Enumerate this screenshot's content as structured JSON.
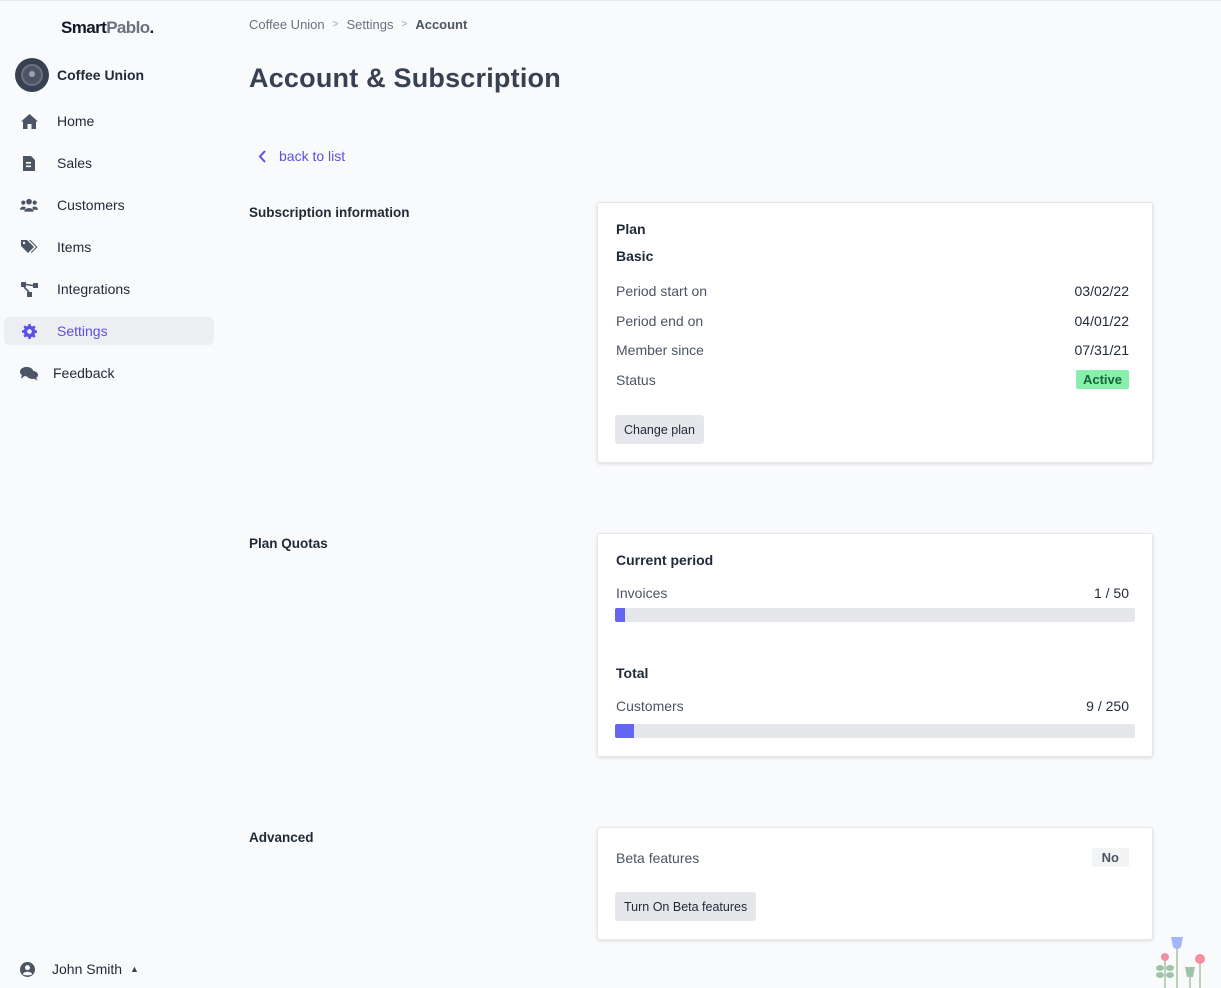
{
  "brand": {
    "smart": "Smart",
    "pablo": "Pablo",
    "dot": "."
  },
  "org": {
    "name": "Coffee Union"
  },
  "sidebar": {
    "items": [
      {
        "label": "Home",
        "icon": "home-icon"
      },
      {
        "label": "Sales",
        "icon": "invoice-icon"
      },
      {
        "label": "Customers",
        "icon": "users-icon"
      },
      {
        "label": "Items",
        "icon": "tags-icon"
      },
      {
        "label": "Integrations",
        "icon": "integrations-icon"
      },
      {
        "label": "Settings",
        "icon": "gear-icon",
        "active": true
      },
      {
        "label": "Feedback",
        "icon": "comments-icon"
      }
    ],
    "user": "John Smith"
  },
  "breadcrumb": [
    "Coffee Union",
    "Settings",
    "Account"
  ],
  "page": {
    "title": "Account & Subscription",
    "back_label": "back to list"
  },
  "subscription": {
    "section_label": "Subscription information",
    "plan_heading": "Plan",
    "plan_name": "Basic",
    "rows": [
      {
        "label": "Period start on",
        "value": "03/02/22"
      },
      {
        "label": "Period end on",
        "value": "04/01/22"
      },
      {
        "label": "Member since",
        "value": "07/31/21"
      }
    ],
    "status_label": "Status",
    "status_value": "Active",
    "change_plan_label": "Change plan"
  },
  "quotas": {
    "section_label": "Plan Quotas",
    "current_heading": "Current period",
    "invoices_label": "Invoices",
    "invoices_value": "1 / 50",
    "invoices_fraction": 0.02,
    "total_heading": "Total",
    "customers_label": "Customers",
    "customers_value": "9 / 250",
    "customers_fraction": 0.036
  },
  "advanced": {
    "section_label": "Advanced",
    "beta_label": "Beta features",
    "beta_value": "No",
    "beta_button_label": "Turn On Beta features"
  },
  "colors": {
    "accent": "#5b50e6",
    "bar_fill": "#6366f1",
    "active_badge": "#86efac"
  }
}
